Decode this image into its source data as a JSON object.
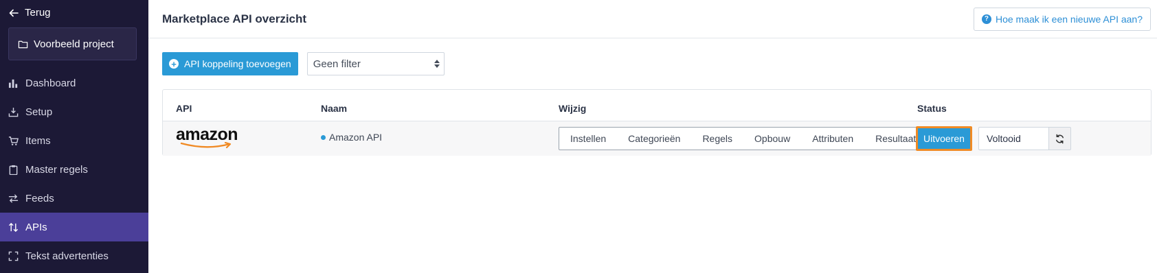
{
  "sidebar": {
    "back_label": "Terug",
    "project_name": "Voorbeeld project",
    "items": [
      {
        "label": "Dashboard",
        "icon": "bar-chart-icon"
      },
      {
        "label": "Setup",
        "icon": "download-tray-icon"
      },
      {
        "label": "Items",
        "icon": "cart-icon"
      },
      {
        "label": "Master regels",
        "icon": "clipboard-icon"
      },
      {
        "label": "Feeds",
        "icon": "arrows-exchange-icon"
      },
      {
        "label": "APIs",
        "icon": "sort-arrows-icon",
        "active": true
      },
      {
        "label": "Tekst advertenties",
        "icon": "expand-icon"
      }
    ]
  },
  "header": {
    "title": "Marketplace API overzicht",
    "help_label": "Hoe maak ik een nieuwe API aan?"
  },
  "toolbar": {
    "add_label": "API koppeling toevoegen",
    "filter_value": "Geen filter"
  },
  "table": {
    "columns": {
      "api": "API",
      "name": "Naam",
      "edit": "Wijzig",
      "status": "Status"
    },
    "row": {
      "logo_text": "amazon",
      "name": "Amazon API",
      "tabs": [
        "Instellen",
        "Categorieën",
        "Regels",
        "Opbouw",
        "Attributen",
        "Resultaat"
      ],
      "run_label": "Uitvoeren",
      "status_value": "Voltooid"
    }
  },
  "colors": {
    "sidebar_bg": "#1c1936",
    "active_item": "#4b3f99",
    "accent": "#2a9ad6",
    "highlight_border": "#f08a24"
  }
}
